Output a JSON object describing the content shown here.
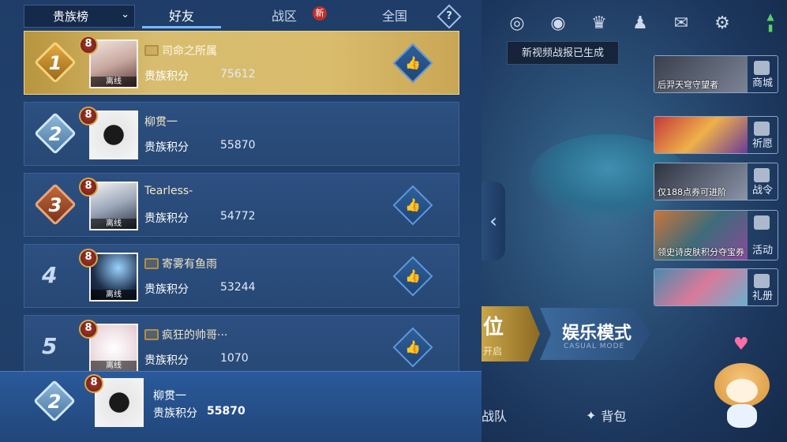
{
  "tabs": {
    "dropdown": "贵族榜",
    "friends": "好友",
    "zone": "战区",
    "zone_badge": "新",
    "national": "全国",
    "help": "?"
  },
  "leaderboard": [
    {
      "rank": "1",
      "level": "8",
      "name": "司命之所属",
      "offline": "离线",
      "score_label": "贵族积分",
      "score": "75612",
      "like": true
    },
    {
      "rank": "2",
      "level": "8",
      "name": "柳贯一",
      "offline": "",
      "score_label": "贵族积分",
      "score": "55870",
      "like": false
    },
    {
      "rank": "3",
      "level": "8",
      "name": "Tearless-",
      "offline": "离线",
      "score_label": "贵族积分",
      "score": "54772",
      "like": true
    },
    {
      "rank": "4",
      "level": "8",
      "name": "寄雾有鱼雨",
      "offline": "离线",
      "score_label": "贵族积分",
      "score": "53244",
      "like": true
    },
    {
      "rank": "5",
      "level": "8",
      "name": "疯狂的帅哥···",
      "offline": "离线",
      "score_label": "贵族积分",
      "score": "1070",
      "like": true
    }
  ],
  "self": {
    "rank": "2",
    "level": "8",
    "name": "柳贯一",
    "score_label": "贵族积分",
    "score": "55870"
  },
  "background": {
    "toast": "新视频战报已生成",
    "side_items": [
      {
        "caption": "后羿天穹守望者",
        "label": "商城"
      },
      {
        "caption": "",
        "label": "祈愿"
      },
      {
        "caption": "仅188点券可进阶",
        "label": "战令"
      },
      {
        "caption": "领史诗皮肤积分夺宝券",
        "label": "活动"
      },
      {
        "caption": "",
        "label": "礼册"
      }
    ],
    "mode_left_title": "位",
    "mode_left_sub": "开启",
    "mode_right_title": "娱乐模式",
    "mode_right_sub": "CASUAL MODE",
    "nav": [
      "战队",
      "背包"
    ]
  },
  "colors": {
    "gold": "#d8bd70",
    "row": "#2d5082",
    "accent": "#79b8ff"
  }
}
